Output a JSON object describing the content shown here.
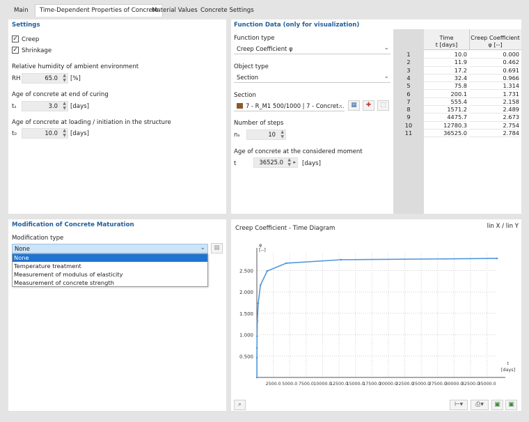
{
  "tabs": [
    "Main",
    "Time-Dependent Properties of Concrete",
    "Material Values",
    "Concrete Settings"
  ],
  "active_tab": 1,
  "settings": {
    "title": "Settings",
    "creep_label": "Creep",
    "creep_checked": true,
    "shrinkage_label": "Shrinkage",
    "shrinkage_checked": true,
    "rh_heading": "Relative humidity of ambient environment",
    "rh_symbol": "RH",
    "rh_value": "65.0",
    "rh_unit": "[%]",
    "curing_heading": "Age of concrete at end of curing",
    "curing_symbol": "tₛ",
    "curing_value": "3.0",
    "curing_unit": "[days]",
    "loading_heading": "Age of concrete at loading / initiation in the structure",
    "loading_symbol": "t₀",
    "loading_value": "10.0",
    "loading_unit": "[days]"
  },
  "function_data": {
    "title": "Function Data (only for visualization)",
    "function_type_label": "Function type",
    "function_type_value": "Creep Coefficient φ",
    "object_type_label": "Object type",
    "object_type_value": "Section",
    "section_label": "Section",
    "section_value": "7 - R_M1 500/1000 | 7 - Concret...",
    "steps_label": "Number of steps",
    "steps_symbol": "nₛ",
    "steps_value": "10",
    "age_label": "Age of concrete at the considered moment",
    "age_symbol": "t",
    "age_value": "36525.0",
    "age_unit": "[days]"
  },
  "table": {
    "col1_h1": "Time",
    "col1_h2": "t [days]",
    "col2_h1": "Creep Coefficient",
    "col2_h2": "φ [--]",
    "rows": [
      [
        "1",
        "10.0",
        "0.000"
      ],
      [
        "2",
        "11.9",
        "0.462"
      ],
      [
        "3",
        "17.2",
        "0.691"
      ],
      [
        "4",
        "32.4",
        "0.966"
      ],
      [
        "5",
        "75.8",
        "1.314"
      ],
      [
        "6",
        "200.1",
        "1.731"
      ],
      [
        "7",
        "555.4",
        "2.158"
      ],
      [
        "8",
        "1571.2",
        "2.489"
      ],
      [
        "9",
        "4475.7",
        "2.673"
      ],
      [
        "10",
        "12780.3",
        "2.754"
      ],
      [
        "11",
        "36525.0",
        "2.784"
      ]
    ]
  },
  "modification": {
    "title": "Modification of Concrete Maturation",
    "type_label": "Modification type",
    "selected": "None",
    "options": [
      "None",
      "Temperature treatment",
      "Measurement of modulus of elasticity",
      "Measurement of concrete strength"
    ]
  },
  "chart_data": {
    "type": "line",
    "title": "Creep Coefficient - Time Diagram",
    "scale_label": "lin X / lin Y",
    "ylabel": "φ",
    "yunit": "[--]",
    "xlabel": "t",
    "xunit": "[days]",
    "x": [
      10.0,
      11.9,
      17.2,
      32.4,
      75.8,
      200.1,
      555.4,
      1571.2,
      4475.7,
      12780.3,
      36525.0
    ],
    "y": [
      0.0,
      0.462,
      0.691,
      0.966,
      1.314,
      1.731,
      2.158,
      2.489,
      2.673,
      2.754,
      2.784
    ],
    "xlim": [
      0,
      36525.0
    ],
    "ylim": [
      0,
      2.9
    ],
    "yticks": [
      "0.500",
      "1.000",
      "1.500",
      "2.000",
      "2.500"
    ],
    "yticks_values": [
      0.5,
      1.0,
      1.5,
      2.0,
      2.5
    ],
    "xticks_labels": [
      "2500.0",
      "5000.0",
      "7500.0",
      "10000.0",
      "12500.0",
      "15000.0",
      "17500.0",
      "20000.0",
      "22500.0",
      "25000.0",
      "27500.0",
      "30000.0",
      "32500.0",
      "35000.0"
    ],
    "xticks_values": [
      2500,
      5000,
      7500,
      10000,
      12500,
      15000,
      17500,
      20000,
      22500,
      25000,
      27500,
      30000,
      32500,
      35000
    ],
    "line_color": "#4f97dc",
    "grid": true
  },
  "colors": {
    "title_blue": "#1f5f9c",
    "selection_blue": "#1e74d0",
    "section_swatch": "#8a5a2b"
  }
}
